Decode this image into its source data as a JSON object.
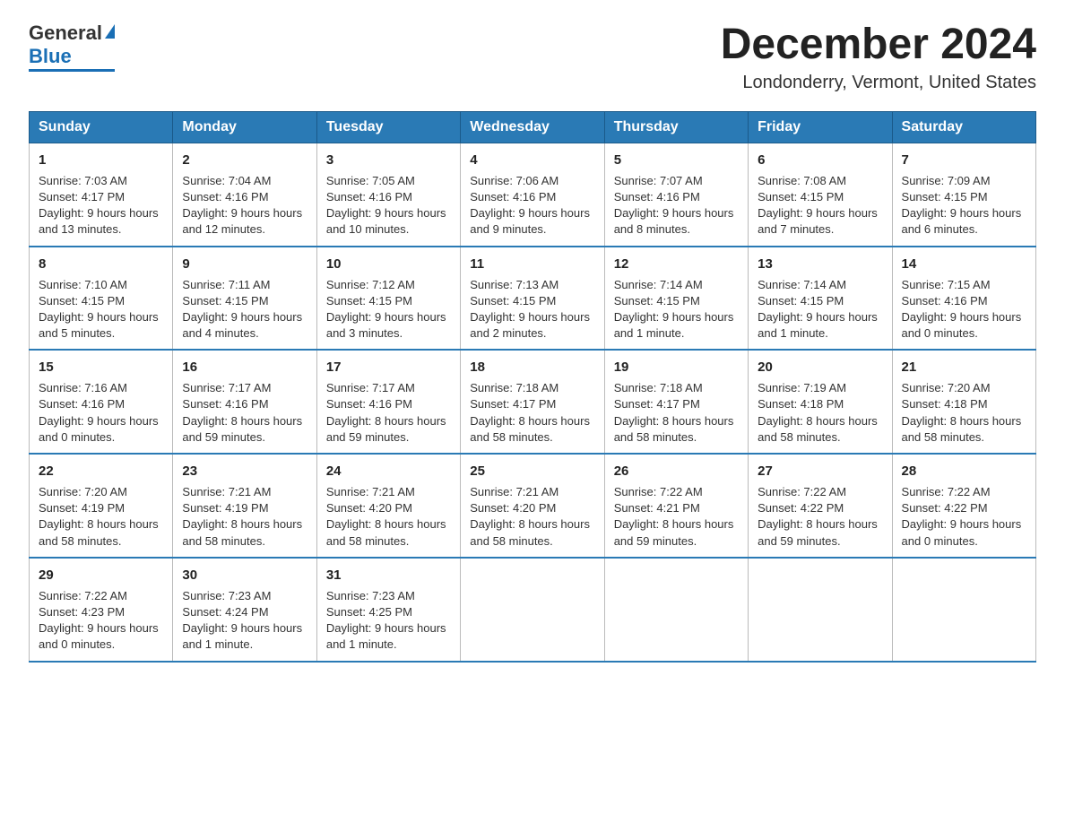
{
  "header": {
    "logo_general": "General",
    "logo_blue": "Blue",
    "title": "December 2024",
    "subtitle": "Londonderry, Vermont, United States"
  },
  "days_of_week": [
    "Sunday",
    "Monday",
    "Tuesday",
    "Wednesday",
    "Thursday",
    "Friday",
    "Saturday"
  ],
  "weeks": [
    [
      {
        "day": "1",
        "sunrise": "7:03 AM",
        "sunset": "4:17 PM",
        "daylight": "9 hours and 13 minutes."
      },
      {
        "day": "2",
        "sunrise": "7:04 AM",
        "sunset": "4:16 PM",
        "daylight": "9 hours and 12 minutes."
      },
      {
        "day": "3",
        "sunrise": "7:05 AM",
        "sunset": "4:16 PM",
        "daylight": "9 hours and 10 minutes."
      },
      {
        "day": "4",
        "sunrise": "7:06 AM",
        "sunset": "4:16 PM",
        "daylight": "9 hours and 9 minutes."
      },
      {
        "day": "5",
        "sunrise": "7:07 AM",
        "sunset": "4:16 PM",
        "daylight": "9 hours and 8 minutes."
      },
      {
        "day": "6",
        "sunrise": "7:08 AM",
        "sunset": "4:15 PM",
        "daylight": "9 hours and 7 minutes."
      },
      {
        "day": "7",
        "sunrise": "7:09 AM",
        "sunset": "4:15 PM",
        "daylight": "9 hours and 6 minutes."
      }
    ],
    [
      {
        "day": "8",
        "sunrise": "7:10 AM",
        "sunset": "4:15 PM",
        "daylight": "9 hours and 5 minutes."
      },
      {
        "day": "9",
        "sunrise": "7:11 AM",
        "sunset": "4:15 PM",
        "daylight": "9 hours and 4 minutes."
      },
      {
        "day": "10",
        "sunrise": "7:12 AM",
        "sunset": "4:15 PM",
        "daylight": "9 hours and 3 minutes."
      },
      {
        "day": "11",
        "sunrise": "7:13 AM",
        "sunset": "4:15 PM",
        "daylight": "9 hours and 2 minutes."
      },
      {
        "day": "12",
        "sunrise": "7:14 AM",
        "sunset": "4:15 PM",
        "daylight": "9 hours and 1 minute."
      },
      {
        "day": "13",
        "sunrise": "7:14 AM",
        "sunset": "4:15 PM",
        "daylight": "9 hours and 1 minute."
      },
      {
        "day": "14",
        "sunrise": "7:15 AM",
        "sunset": "4:16 PM",
        "daylight": "9 hours and 0 minutes."
      }
    ],
    [
      {
        "day": "15",
        "sunrise": "7:16 AM",
        "sunset": "4:16 PM",
        "daylight": "9 hours and 0 minutes."
      },
      {
        "day": "16",
        "sunrise": "7:17 AM",
        "sunset": "4:16 PM",
        "daylight": "8 hours and 59 minutes."
      },
      {
        "day": "17",
        "sunrise": "7:17 AM",
        "sunset": "4:16 PM",
        "daylight": "8 hours and 59 minutes."
      },
      {
        "day": "18",
        "sunrise": "7:18 AM",
        "sunset": "4:17 PM",
        "daylight": "8 hours and 58 minutes."
      },
      {
        "day": "19",
        "sunrise": "7:18 AM",
        "sunset": "4:17 PM",
        "daylight": "8 hours and 58 minutes."
      },
      {
        "day": "20",
        "sunrise": "7:19 AM",
        "sunset": "4:18 PM",
        "daylight": "8 hours and 58 minutes."
      },
      {
        "day": "21",
        "sunrise": "7:20 AM",
        "sunset": "4:18 PM",
        "daylight": "8 hours and 58 minutes."
      }
    ],
    [
      {
        "day": "22",
        "sunrise": "7:20 AM",
        "sunset": "4:19 PM",
        "daylight": "8 hours and 58 minutes."
      },
      {
        "day": "23",
        "sunrise": "7:21 AM",
        "sunset": "4:19 PM",
        "daylight": "8 hours and 58 minutes."
      },
      {
        "day": "24",
        "sunrise": "7:21 AM",
        "sunset": "4:20 PM",
        "daylight": "8 hours and 58 minutes."
      },
      {
        "day": "25",
        "sunrise": "7:21 AM",
        "sunset": "4:20 PM",
        "daylight": "8 hours and 58 minutes."
      },
      {
        "day": "26",
        "sunrise": "7:22 AM",
        "sunset": "4:21 PM",
        "daylight": "8 hours and 59 minutes."
      },
      {
        "day": "27",
        "sunrise": "7:22 AM",
        "sunset": "4:22 PM",
        "daylight": "8 hours and 59 minutes."
      },
      {
        "day": "28",
        "sunrise": "7:22 AM",
        "sunset": "4:22 PM",
        "daylight": "9 hours and 0 minutes."
      }
    ],
    [
      {
        "day": "29",
        "sunrise": "7:22 AM",
        "sunset": "4:23 PM",
        "daylight": "9 hours and 0 minutes."
      },
      {
        "day": "30",
        "sunrise": "7:23 AM",
        "sunset": "4:24 PM",
        "daylight": "9 hours and 1 minute."
      },
      {
        "day": "31",
        "sunrise": "7:23 AM",
        "sunset": "4:25 PM",
        "daylight": "9 hours and 1 minute."
      },
      null,
      null,
      null,
      null
    ]
  ],
  "labels": {
    "sunrise": "Sunrise:",
    "sunset": "Sunset:",
    "daylight": "Daylight:"
  }
}
